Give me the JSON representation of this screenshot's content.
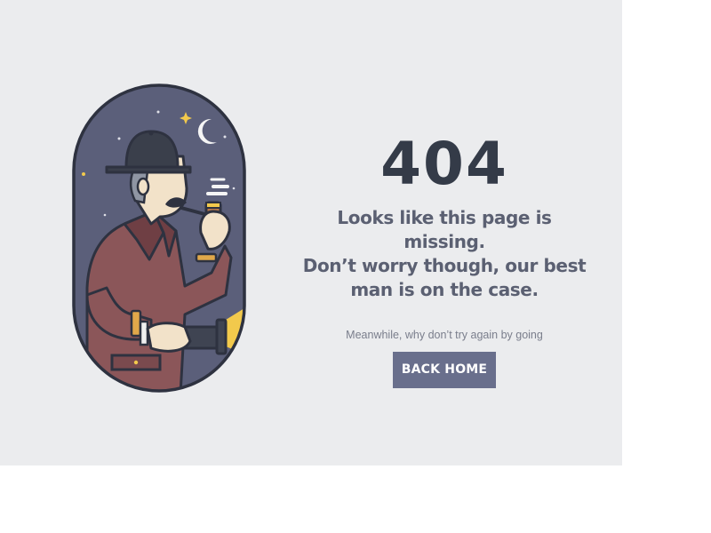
{
  "error": {
    "code": "404",
    "message_lines": [
      "Looks like this page is missing.",
      "Don’t worry though, our best",
      "man is on the case."
    ],
    "subtext": "Meanwhile, why don’t try again by going",
    "button_label": "BACK HOME"
  },
  "illustration": {
    "name": "detective-icon",
    "description_icon": "detective-with-pipe-and-flashlight-icon"
  },
  "colors": {
    "background": "#ebecee",
    "heading": "#343b48",
    "message": "#5b6072",
    "button": "#696f8c",
    "night_sky": "#5b5f7a"
  }
}
